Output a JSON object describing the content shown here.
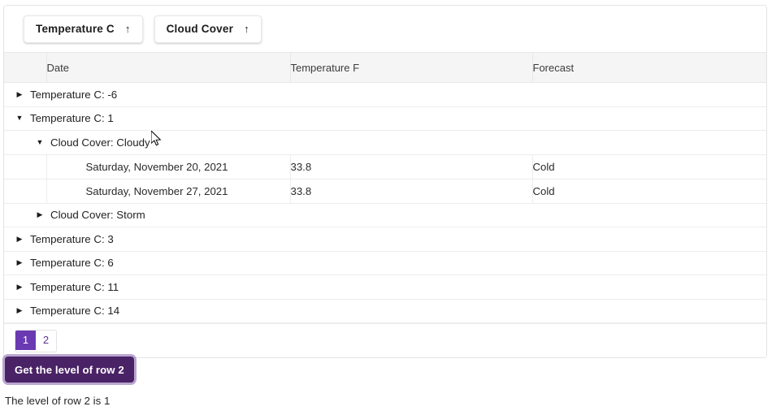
{
  "sort_toolbar": {
    "buttons": [
      {
        "label": "Temperature C",
        "arrow": "↑",
        "icon": "arrow-up-icon"
      },
      {
        "label": "Cloud Cover",
        "arrow": "↑",
        "icon": "arrow-up-icon"
      }
    ]
  },
  "table": {
    "columns": [
      {
        "key": "expander",
        "label": ""
      },
      {
        "key": "date",
        "label": "Date"
      },
      {
        "key": "temperature_f",
        "label": "Temperature F"
      },
      {
        "key": "forecast",
        "label": "Forecast"
      }
    ],
    "rows": [
      {
        "type": "group",
        "level": 1,
        "expanded": false,
        "icon": "triangle-right-icon",
        "glyph": "▶",
        "label": "Temperature C: -6"
      },
      {
        "type": "group",
        "level": 1,
        "expanded": true,
        "icon": "triangle-down-icon",
        "glyph": "▼",
        "label": "Temperature C: 1"
      },
      {
        "type": "group",
        "level": 2,
        "expanded": true,
        "icon": "triangle-down-icon",
        "glyph": "▼",
        "label": "Cloud Cover: Cloudy"
      },
      {
        "type": "data",
        "date": "Saturday, November 20, 2021",
        "temperature_f": "33.8",
        "forecast": "Cold"
      },
      {
        "type": "data",
        "date": "Saturday, November 27, 2021",
        "temperature_f": "33.8",
        "forecast": "Cold"
      },
      {
        "type": "group",
        "level": 2,
        "expanded": false,
        "icon": "triangle-right-icon",
        "glyph": "▶",
        "label": "Cloud Cover: Storm"
      },
      {
        "type": "group",
        "level": 1,
        "expanded": false,
        "icon": "triangle-right-icon",
        "glyph": "▶",
        "label": "Temperature C: 3"
      },
      {
        "type": "group",
        "level": 1,
        "expanded": false,
        "icon": "triangle-right-icon",
        "glyph": "▶",
        "label": "Temperature C: 6"
      },
      {
        "type": "group",
        "level": 1,
        "expanded": false,
        "icon": "triangle-right-icon",
        "glyph": "▶",
        "label": "Temperature C: 11"
      },
      {
        "type": "group",
        "level": 1,
        "expanded": false,
        "icon": "triangle-right-icon",
        "glyph": "▶",
        "label": "Temperature C: 14"
      }
    ]
  },
  "paginator": {
    "pages": [
      {
        "label": "1",
        "active": true
      },
      {
        "label": "2",
        "active": false
      }
    ]
  },
  "action": {
    "level_button_label": "Get the level of row 2"
  },
  "status": {
    "text": "The level of row 2 is 1"
  },
  "colors": {
    "accent_purple": "#6a3ab2",
    "button_purple": "#4a2266",
    "focus_ring": "rgba(130,92,170,0.55)",
    "header_bg": "#f5f5f5",
    "border": "#e8e8e8"
  }
}
